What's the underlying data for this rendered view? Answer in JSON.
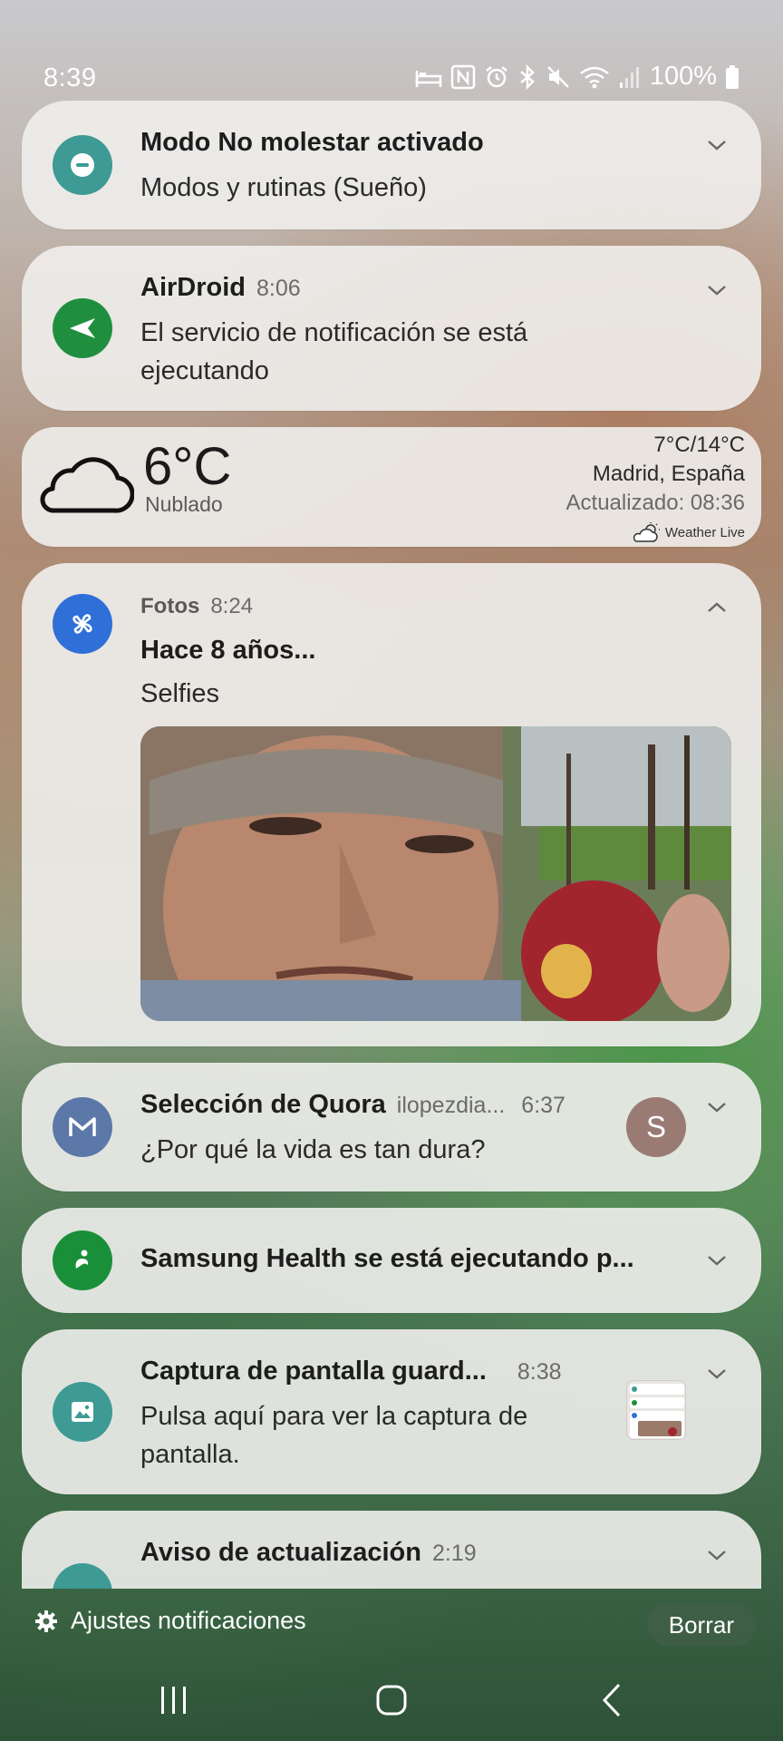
{
  "status_bar": {
    "time": "8:39",
    "battery": "100%",
    "icons": [
      "sleep-mode-icon",
      "nfc-icon",
      "alarm-icon",
      "bluetooth-icon",
      "mute-icon",
      "wifi-icon",
      "signal-icon",
      "battery-icon"
    ]
  },
  "notifications": {
    "dnd": {
      "title": "Modo No molestar activado",
      "body": "Modos y rutinas (Sueño)",
      "icon": "minus-circle-icon",
      "icon_color": "#3e9a94"
    },
    "airdroid": {
      "app": "AirDroid",
      "time": "8:06",
      "body": "El servicio de notificación se está ejecutando",
      "icon": "paper-plane-icon",
      "icon_color": "#1f8f3f"
    },
    "weather": {
      "temp": "6°C",
      "condition": "Nublado",
      "range": "7°C/14°C",
      "location": "Madrid, España",
      "updated": "Actualizado: 08:36",
      "brand": "Weather Live",
      "icon": "cloud-icon"
    },
    "photos": {
      "app": "Fotos",
      "time": "8:24",
      "title": "Hace 8 años...",
      "body": "Selfies",
      "icon": "pinwheel-icon",
      "icon_color": "#2f6fd8"
    },
    "quora": {
      "title": "Selección de Quora",
      "account": "ilopezdia...",
      "time": "6:37",
      "body": "¿Por qué la vida es tan dura?",
      "avatar_letter": "S",
      "icon": "mail-m-icon",
      "icon_color": "#5b78a8"
    },
    "health": {
      "title": "Samsung Health se está ejecutando p...",
      "icon": "health-person-icon",
      "icon_color": "#1a8f3a"
    },
    "screenshot": {
      "title": "Captura de pantalla guard...",
      "time": "8:38",
      "body": "Pulsa aquí para ver la captura de pantalla.",
      "icon": "image-icon",
      "icon_color": "#3e9a94"
    },
    "update": {
      "title": "Aviso de actualización",
      "time": "2:19"
    }
  },
  "bottom": {
    "settings_label": "Ajustes notificaciones",
    "clear_label": "Borrar"
  }
}
